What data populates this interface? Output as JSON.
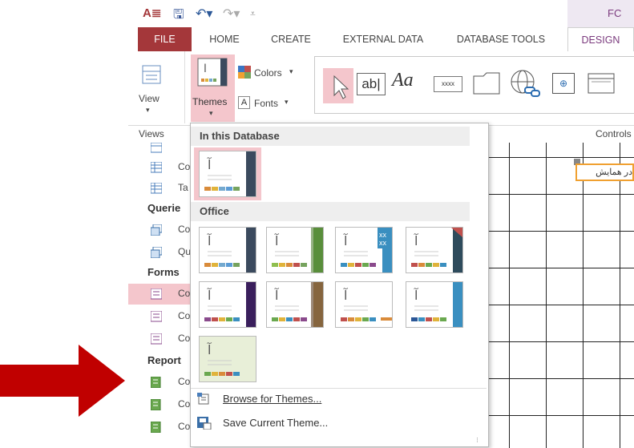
{
  "title_bar": {
    "context_tab_partial": "FC"
  },
  "tabs": [
    {
      "label": "FILE"
    },
    {
      "label": "HOME"
    },
    {
      "label": "CREATE"
    },
    {
      "label": "EXTERNAL DATA"
    },
    {
      "label": "DATABASE TOOLS"
    },
    {
      "label": "DESIGN"
    }
  ],
  "ribbon": {
    "view_label": "View",
    "themes_label": "Themes",
    "colors_label": "Colors",
    "fonts_label": "Fonts",
    "groups": {
      "views": "Views",
      "controls": "Controls"
    },
    "controls": [
      "select-pointer",
      "text-box",
      "label",
      "button",
      "tab-control",
      "hyperlink",
      "web-browser",
      "navigation-control"
    ],
    "label_glyph": "Aa",
    "textbox_glyph": "ab|",
    "button_glyph": "xxxx"
  },
  "nav_pane": {
    "items": [
      {
        "label": "Co",
        "icon": "table-icon"
      },
      {
        "label": "Ta",
        "icon": "table-icon"
      },
      {
        "label": "Co",
        "icon": "query-icon"
      },
      {
        "label": "Qu",
        "icon": "query-icon"
      },
      {
        "label": "Co",
        "icon": "form-icon",
        "selected": true
      },
      {
        "label": "Co",
        "icon": "form-icon"
      },
      {
        "label": "Co",
        "icon": "form-icon"
      },
      {
        "label": "Co",
        "icon": "report-icon"
      },
      {
        "label": "Co",
        "icon": "report-icon"
      },
      {
        "label": "Co",
        "icon": "report-icon"
      }
    ],
    "headers": {
      "queries": "Querie",
      "forms": "Forms",
      "reports": "Report"
    }
  },
  "design_surface": {
    "field_label": "در همایش"
  },
  "dropdown": {
    "section_database": "In this Database",
    "section_office": "Office",
    "browse_label": "Browse for Themes...",
    "save_label": "Save Current Theme...",
    "glyph": "آ"
  },
  "colors": {
    "accent_red": "#a4373a",
    "highlight_pink": "#f4c6cc",
    "design_purple": "#7b3b7e",
    "arrow_red": "#c00000"
  }
}
